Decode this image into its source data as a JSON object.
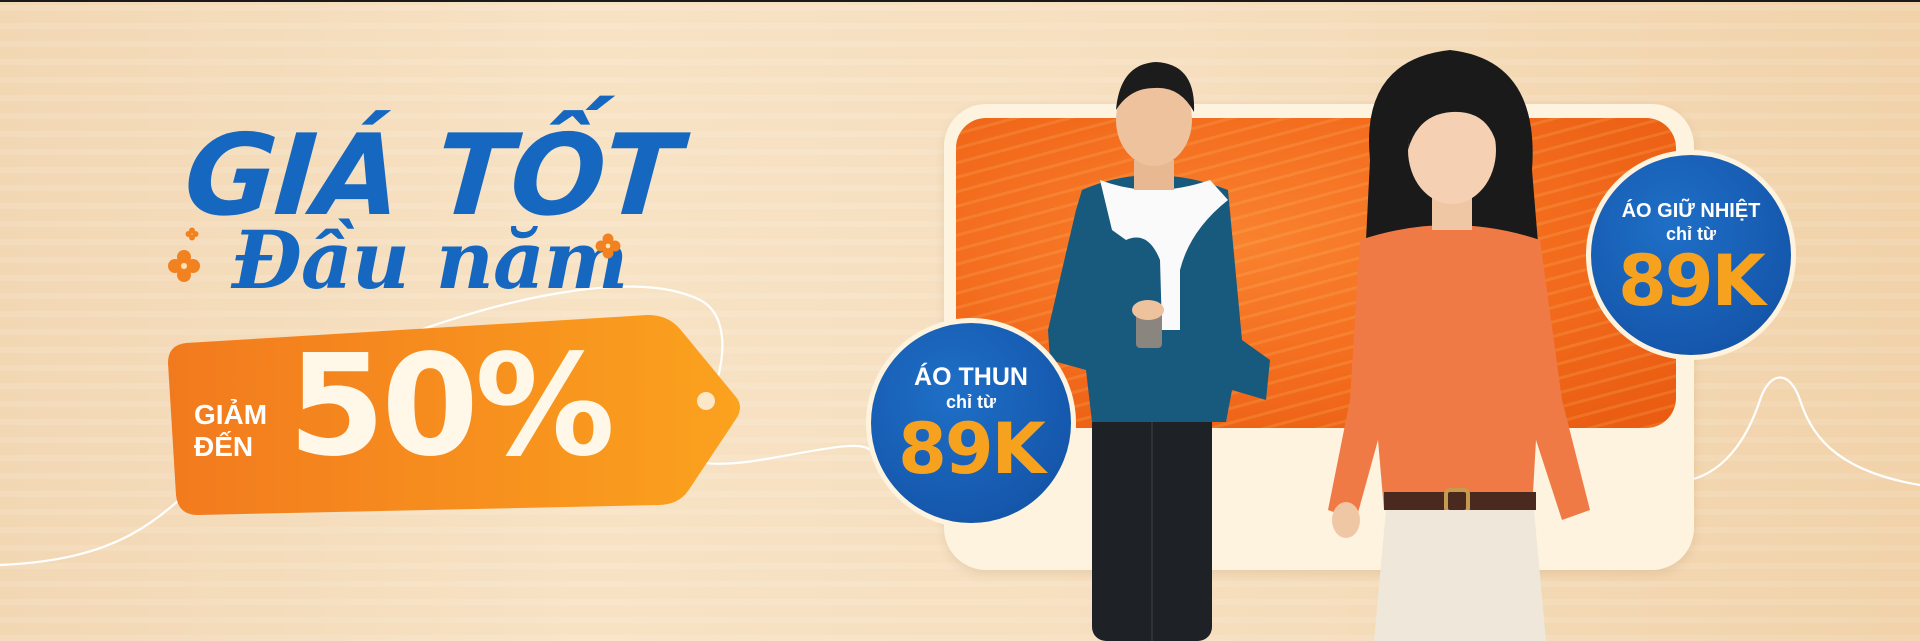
{
  "banner": {
    "headline_line1": "GIÁ TỐT",
    "headline_line2": "Đầu năm",
    "tag": {
      "prefix_line1": "GIẢM",
      "prefix_line2": "ĐẾN",
      "discount": "50%"
    },
    "badges": [
      {
        "title": "ÁO THUN",
        "subtitle": "chỉ từ",
        "price": "89K"
      },
      {
        "title": "ÁO GIỮ NHIỆT",
        "subtitle": "chỉ từ",
        "price": "89K"
      }
    ],
    "colors": {
      "brand_blue": "#1667bf",
      "accent_orange": "#f7931e",
      "price_orange": "#f7a21f",
      "background_cream": "#f6dfbf"
    },
    "icons": [
      "flower-icon",
      "man-model-image",
      "woman-model-image"
    ]
  }
}
